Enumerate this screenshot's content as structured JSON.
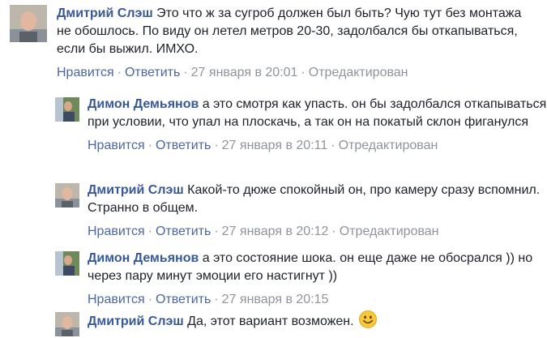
{
  "labels": {
    "like": "Нравится",
    "reply": "Ответить",
    "separator": "·"
  },
  "comments": [
    {
      "author": "Дмитрий Слэш",
      "text_lines": [
        "Это что ж за сугроб должен был быть? Чую тут без монтажа",
        "не обошлось. По виду он летел метров 20-30, задолбался бы откапываться,",
        "если бы выжил. ИМХО."
      ],
      "time": "27 января в 20:01",
      "edited": "Отредактирован"
    },
    {
      "author": "Димон Демьянов",
      "text": "а это смотря как упасть. он бы задолбался откапываться при условии, что упал на плоскачь, а так он на покатый склон фиганулся",
      "time": "27 января в 20:11",
      "edited": "Отредактирован"
    },
    {
      "author": "Дмитрий Слэш",
      "text": "Какой-то дюже спокойный он, про камеру сразу вспомнил. Странно в общем.",
      "time": "27 января в 20:12",
      "edited": "Отредактирован"
    },
    {
      "author": "Димон Демьянов",
      "text": "а это состояние шока. он еще даже не обосрался )) но через пару минут эмоции его настигнут ))",
      "time": "27 января в 20:15",
      "edited": ""
    },
    {
      "author": "Дмитрий Слэш",
      "text": "Да, этот вариант возможен.",
      "emoji": "smiley-face-emoji"
    }
  ],
  "colors": {
    "author": "#385898",
    "action": "#4b67a1",
    "meta": "#90949c",
    "text": "#1d2129"
  }
}
